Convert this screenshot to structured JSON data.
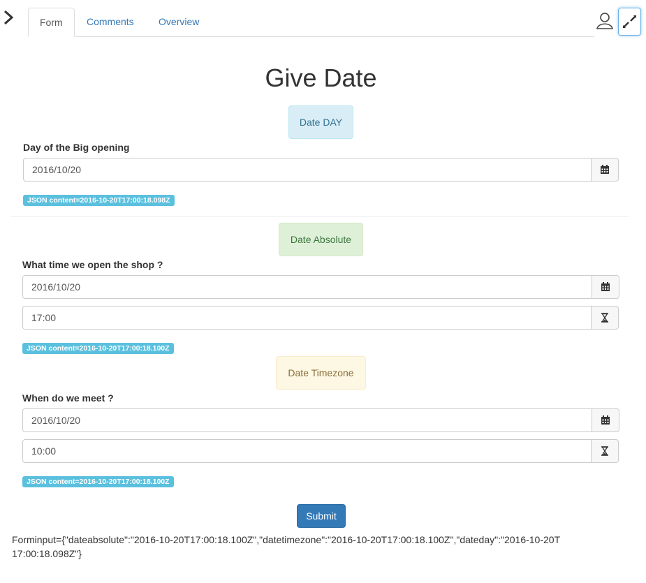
{
  "tabs": [
    "Form",
    "Comments",
    "Overview"
  ],
  "title": "Give Date",
  "sections": {
    "day": {
      "pill": "Date DAY",
      "label": "Day of the Big opening",
      "date": "2016/10/20",
      "json": "JSON content=2016-10-20T17:00:18.098Z"
    },
    "absolute": {
      "pill": "Date Absolute",
      "label": "What time we open the shop ?",
      "date": "2016/10/20",
      "time": "17:00",
      "json": "JSON content=2016-10-20T17:00:18.100Z"
    },
    "timezone": {
      "pill": "Date Timezone",
      "label": "When do we meet ?",
      "date": "2016/10/20",
      "time": "10:00",
      "json": "JSON content=2016-10-20T17:00:18.100Z"
    }
  },
  "submit_label": "Submit",
  "output": "Forminput={\"dateabsolute\":\"2016-10-20T17:00:18.100Z\",\"datetimezone\":\"2016-10-20T17:00:18.100Z\",\"dateday\":\"2016-10-20T17:00:18.098Z\"}",
  "icons": {
    "sidebar": "chevron-right-icon",
    "user": "user-icon",
    "fullscreen": "expand-icon",
    "calendar": "calendar-icon",
    "time": "hourglass-icon"
  },
  "colors": {
    "link": "#337ab7",
    "primary": "#337ab7",
    "badge": "#5bc0de",
    "info_bg": "#d9edf7",
    "success_bg": "#dff0d8",
    "warning_bg": "#fcf8e3"
  }
}
